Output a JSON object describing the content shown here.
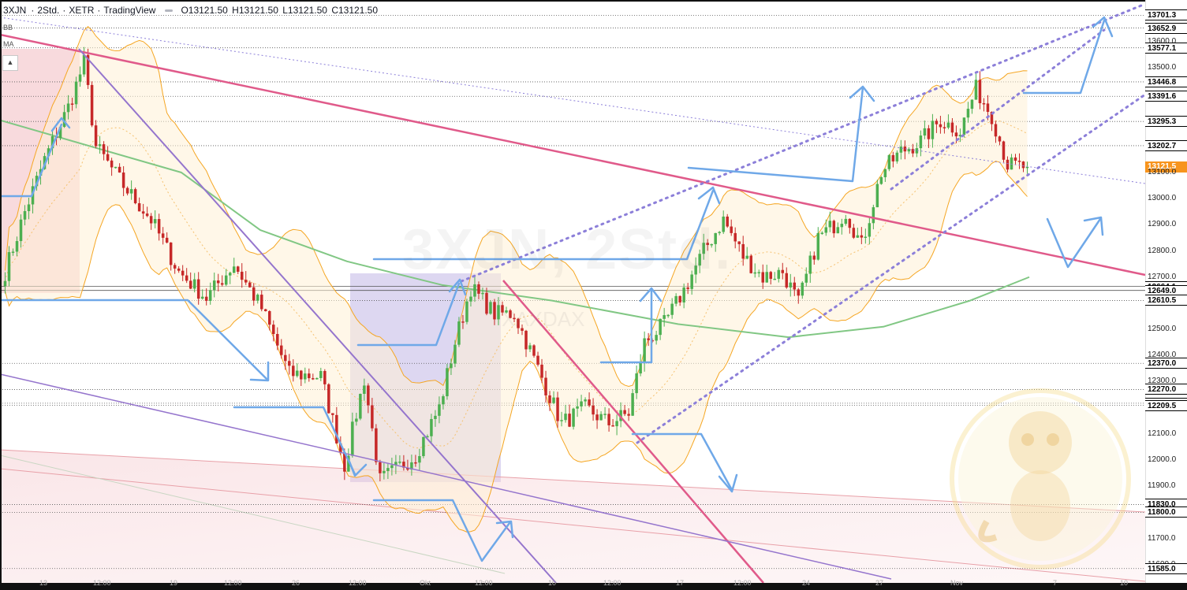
{
  "header": {
    "symbol": "3XJN",
    "interval": "2Std.",
    "exchange": "XETR",
    "platform": "TradingView",
    "open": "O13121.50",
    "high": "H13121.50",
    "low": "L13121.50",
    "close": "C13121.50"
  },
  "indicators": {
    "bb": "BB",
    "ma": "MA"
  },
  "watermark": {
    "main": "3XJN, 2Std.",
    "sub": "XAXDAX"
  },
  "price_labels": [
    {
      "text": "13701.3",
      "style": "box"
    },
    {
      "text": "13652.9",
      "style": "box"
    },
    {
      "text": "13600.0",
      "style": "plain"
    },
    {
      "text": "13577.1",
      "style": "box"
    },
    {
      "text": "13500.0",
      "style": "plain"
    },
    {
      "text": "13446.8",
      "style": "box"
    },
    {
      "text": "13391.6",
      "style": "box"
    },
    {
      "text": "13295.3",
      "style": "box"
    },
    {
      "text": "13202.7",
      "style": "box"
    },
    {
      "text": "13121.5",
      "style": "current"
    },
    {
      "text": "13100.0",
      "style": "plain"
    },
    {
      "text": "13000.0",
      "style": "plain"
    },
    {
      "text": "12900.0",
      "style": "plain"
    },
    {
      "text": "12800.0",
      "style": "plain"
    },
    {
      "text": "12700.0",
      "style": "plain"
    },
    {
      "text": "12664.1",
      "style": "box"
    },
    {
      "text": "12649.0",
      "style": "box"
    },
    {
      "text": "12610.5",
      "style": "box"
    },
    {
      "text": "12500.0",
      "style": "plain"
    },
    {
      "text": "12400.0",
      "style": "plain"
    },
    {
      "text": "12370.0",
      "style": "box"
    },
    {
      "text": "12300.0",
      "style": "plain"
    },
    {
      "text": "12270.0",
      "style": "box"
    },
    {
      "text": "12217.4",
      "style": "box"
    },
    {
      "text": "12209.5",
      "style": "box"
    },
    {
      "text": "12100.0",
      "style": "plain"
    },
    {
      "text": "12000.0",
      "style": "plain"
    },
    {
      "text": "11900.0",
      "style": "plain"
    },
    {
      "text": "11830.0",
      "style": "box"
    },
    {
      "text": "11800.0",
      "style": "box"
    },
    {
      "text": "11700.0",
      "style": "plain"
    },
    {
      "text": "11600.0",
      "style": "plain"
    },
    {
      "text": "11585.0",
      "style": "box"
    }
  ],
  "time_labels": [
    "13",
    "12:00",
    "19",
    "12:00",
    "26",
    "12:00",
    "Okt",
    "12:00",
    "10",
    "12:00",
    "17",
    "12:00",
    "24",
    "27",
    "Nov",
    "7",
    "10"
  ],
  "colors": {
    "up": "#4caf50",
    "down": "#c62828",
    "bb_band": "#f5a623",
    "bb_fill": "#fff3dc",
    "ma_slow": "#81c784",
    "trend_pink": "#e05a8a",
    "trend_purple": "#9575cd",
    "arrows": "#6fa8e8",
    "current_price": "#f7941d"
  },
  "chart_data": {
    "type": "candlestick",
    "title": "3XJN, 2Std., XETR",
    "ylim": [
      11530,
      13760
    ],
    "y_ticks": [
      11600,
      11700,
      11800,
      11900,
      12000,
      12100,
      12200,
      12300,
      12400,
      12500,
      12600,
      12700,
      12800,
      12900,
      13000,
      13100,
      13200,
      13300,
      13400,
      13500,
      13600,
      13700
    ],
    "horizontal_levels": [
      13701.3,
      13652.9,
      13577.1,
      13446.8,
      13391.6,
      13295.3,
      13202.7,
      12664.1,
      12649.0,
      12610.5,
      12370.0,
      12270.0,
      12217.4,
      12209.5,
      11830.0,
      11800.0,
      11585.0
    ],
    "current_price": 13121.5,
    "anchors": [
      {
        "i": 0,
        "p": 12720
      },
      {
        "i": 5,
        "p": 12950
      },
      {
        "i": 10,
        "p": 13150
      },
      {
        "i": 16,
        "p": 13350
      },
      {
        "i": 20,
        "p": 13520
      },
      {
        "i": 23,
        "p": 13200
      },
      {
        "i": 30,
        "p": 13050
      },
      {
        "i": 37,
        "p": 12920
      },
      {
        "i": 44,
        "p": 12720
      },
      {
        "i": 51,
        "p": 12620
      },
      {
        "i": 58,
        "p": 12750
      },
      {
        "i": 65,
        "p": 12580
      },
      {
        "i": 72,
        "p": 12330
      },
      {
        "i": 80,
        "p": 12320
      },
      {
        "i": 86,
        "p": 11980
      },
      {
        "i": 91,
        "p": 12310
      },
      {
        "i": 95,
        "p": 11920
      },
      {
        "i": 104,
        "p": 12020
      },
      {
        "i": 110,
        "p": 12200
      },
      {
        "i": 114,
        "p": 12450
      },
      {
        "i": 118,
        "p": 12660
      },
      {
        "i": 124,
        "p": 12560
      },
      {
        "i": 129,
        "p": 12560
      },
      {
        "i": 135,
        "p": 12350
      },
      {
        "i": 141,
        "p": 12140
      },
      {
        "i": 147,
        "p": 12200
      },
      {
        "i": 153,
        "p": 12140
      },
      {
        "i": 158,
        "p": 12180
      },
      {
        "i": 162,
        "p": 12450
      },
      {
        "i": 167,
        "p": 12520
      },
      {
        "i": 172,
        "p": 12650
      },
      {
        "i": 177,
        "p": 12800
      },
      {
        "i": 182,
        "p": 12920
      },
      {
        "i": 187,
        "p": 12780
      },
      {
        "i": 192,
        "p": 12700
      },
      {
        "i": 197,
        "p": 12720
      },
      {
        "i": 201,
        "p": 12600
      },
      {
        "i": 206,
        "p": 12850
      },
      {
        "i": 210,
        "p": 12900
      },
      {
        "i": 213,
        "p": 12950
      },
      {
        "i": 217,
        "p": 12820
      },
      {
        "i": 222,
        "p": 13100
      },
      {
        "i": 227,
        "p": 13180
      },
      {
        "i": 232,
        "p": 13220
      },
      {
        "i": 237,
        "p": 13300
      },
      {
        "i": 242,
        "p": 13260
      },
      {
        "i": 246,
        "p": 13420
      },
      {
        "i": 250,
        "p": 13320
      },
      {
        "i": 254,
        "p": 13130
      },
      {
        "i": 258,
        "p": 13121.5
      }
    ]
  }
}
